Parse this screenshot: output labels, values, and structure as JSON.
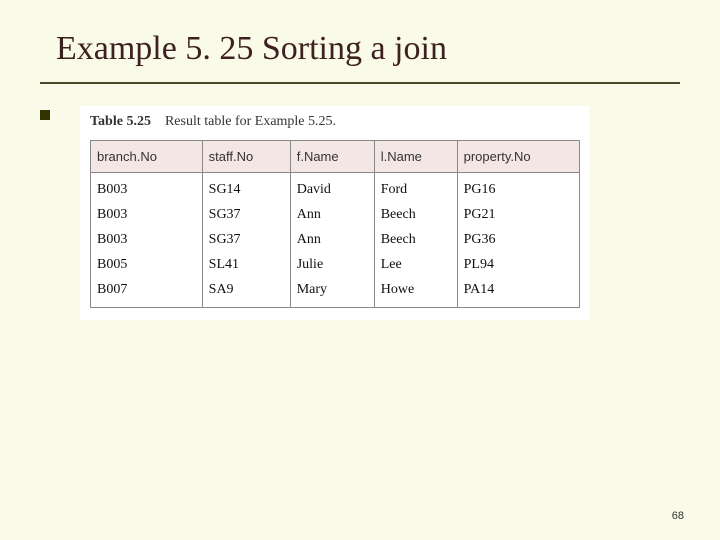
{
  "title": "Example 5. 25  Sorting a join",
  "caption_label": "Table 5.25",
  "caption_text": "Result table for Example 5.25.",
  "page_number": "68",
  "table": {
    "headers": [
      "branch.No",
      "staff.No",
      "f.Name",
      "l.Name",
      "property.No"
    ],
    "rows": [
      [
        "B003",
        "SG14",
        "David",
        "Ford",
        "PG16"
      ],
      [
        "B003",
        "SG37",
        "Ann",
        "Beech",
        "PG21"
      ],
      [
        "B003",
        "SG37",
        "Ann",
        "Beech",
        "PG36"
      ],
      [
        "B005",
        "SL41",
        "Julie",
        "Lee",
        "PL94"
      ],
      [
        "B007",
        "SA9",
        "Mary",
        "Howe",
        "PA14"
      ]
    ]
  }
}
